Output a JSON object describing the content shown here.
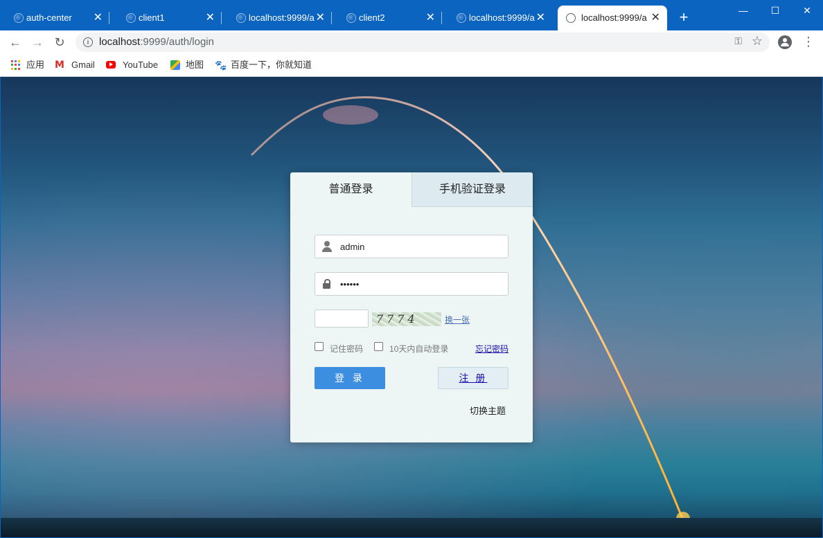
{
  "tabs": [
    {
      "title": "auth-center",
      "close": "✕"
    },
    {
      "title": "client1",
      "close": "✕"
    },
    {
      "title": "localhost:9999/a",
      "close": "✕"
    },
    {
      "title": "client2",
      "close": "✕"
    },
    {
      "title": "localhost:9999/a",
      "close": "✕"
    },
    {
      "title": "localhost:9999/a",
      "close": "✕"
    }
  ],
  "new_tab": "+",
  "window_controls": {
    "minimize": "—",
    "maximize": "☐",
    "close": "✕"
  },
  "toolbar": {
    "back": "←",
    "forward": "→",
    "reload": "↻",
    "url_host": "localhost",
    "url_path": ":9999/auth/login",
    "key": "⚿",
    "star": "☆",
    "menu": "⋮"
  },
  "bookmarks": [
    {
      "label": "应用",
      "icon": "apps-grid-icon"
    },
    {
      "label": "Gmail",
      "icon": "gmail-icon"
    },
    {
      "label": "YouTube",
      "icon": "youtube-icon"
    },
    {
      "label": "地图",
      "icon": "maps-icon"
    },
    {
      "label": "百度一下，你就知道",
      "icon": "baidu-icon"
    }
  ],
  "login": {
    "tab_normal": "普通登录",
    "tab_sms": "手机验证登录",
    "username": "admin",
    "password": "••••••",
    "captcha_text": "7774",
    "refresh_captcha": "换一张",
    "remember_password": "记住密码",
    "auto_login": "10天内自动登录",
    "forgot_password": "忘记密码",
    "login_button": "登 录",
    "register_button": "注 册",
    "switch_theme": "切换主题"
  },
  "colors": {
    "chrome_blue": "#0b64c0",
    "login_button": "#3c8ee0",
    "card_bg": "#eef6f5",
    "link": "#1a0dab"
  }
}
